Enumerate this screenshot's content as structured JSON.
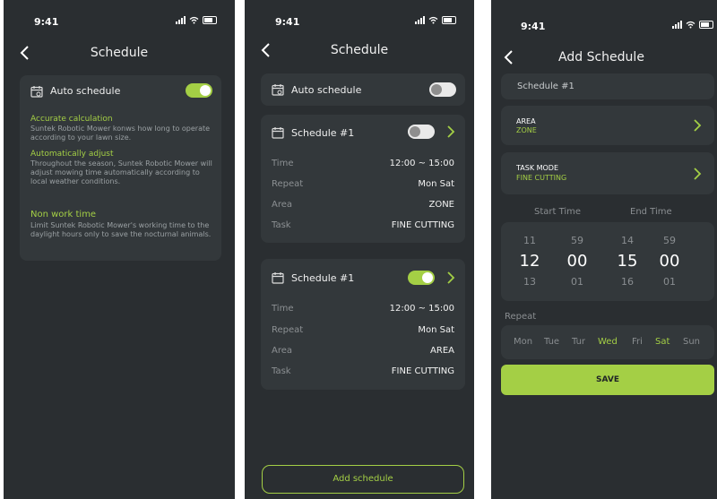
{
  "status": {
    "time": "9:41"
  },
  "screen1": {
    "title": "Schedule",
    "auto_label": "Auto schedule",
    "auto_on": true,
    "info": [
      {
        "heading": "Accurate calculation",
        "body": "Suntek Robotic Mower konws how long to operate according to your lawn size."
      },
      {
        "heading": "Automatically adjust",
        "body": "Throughout the season, Suntek Robotic Mower will adjust mowing time automatically according to local weather conditions."
      },
      {
        "heading": "Non work time",
        "body": "Limit Suntek Robotic Mower's working time to the daylight hours only to save the nocturnal animals."
      }
    ]
  },
  "screen2": {
    "title": "Schedule",
    "auto_label": "Auto schedule",
    "auto_on": false,
    "schedules": [
      {
        "name": "Schedule #1",
        "enabled": false,
        "time_label": "Time",
        "time": "12:00 ~ 15:00",
        "repeat_label": "Repeat",
        "repeat": "Mon Sat",
        "area_label": "Area",
        "area": "ZONE",
        "task_label": "Task",
        "task": "FINE CUTTING"
      },
      {
        "name": "Schedule #1",
        "enabled": true,
        "time_label": "Time",
        "time": "12:00 ~ 15:00",
        "repeat_label": "Repeat",
        "repeat": "Mon Sat",
        "area_label": "Area",
        "area": "AREA",
        "task_label": "Task",
        "task": "FINE CUTTING"
      }
    ],
    "add_button": "Add schedule"
  },
  "screen3": {
    "title": "Add Schedule",
    "name": "Schedule #1",
    "area_label": "AREA",
    "area_value": "ZONE",
    "task_label": "TASK MODE",
    "task_value": "FINE CUTTING",
    "start_label": "Start Time",
    "end_label": "End Time",
    "picker": {
      "start_hour": [
        "11",
        "12",
        "13"
      ],
      "start_min": [
        "59",
        "00",
        "01"
      ],
      "end_hour": [
        "14",
        "15",
        "16"
      ],
      "end_min": [
        "59",
        "00",
        "01"
      ]
    },
    "repeat_label": "Repeat",
    "days": [
      {
        "label": "Mon",
        "selected": false
      },
      {
        "label": "Tue",
        "selected": false
      },
      {
        "label": "Tur",
        "selected": false
      },
      {
        "label": "Wed",
        "selected": true
      },
      {
        "label": "Fri",
        "selected": false
      },
      {
        "label": "Sat",
        "selected": true
      },
      {
        "label": "Sun",
        "selected": false
      }
    ],
    "save_button": "SAVE"
  },
  "colors": {
    "accent": "#a4cf45",
    "background": "#2a2e31",
    "card": "#33383b"
  },
  "icons": [
    "back-arrow-icon",
    "calendar-icon",
    "chevron-right-icon",
    "signal-icon",
    "wifi-icon",
    "battery-icon"
  ]
}
